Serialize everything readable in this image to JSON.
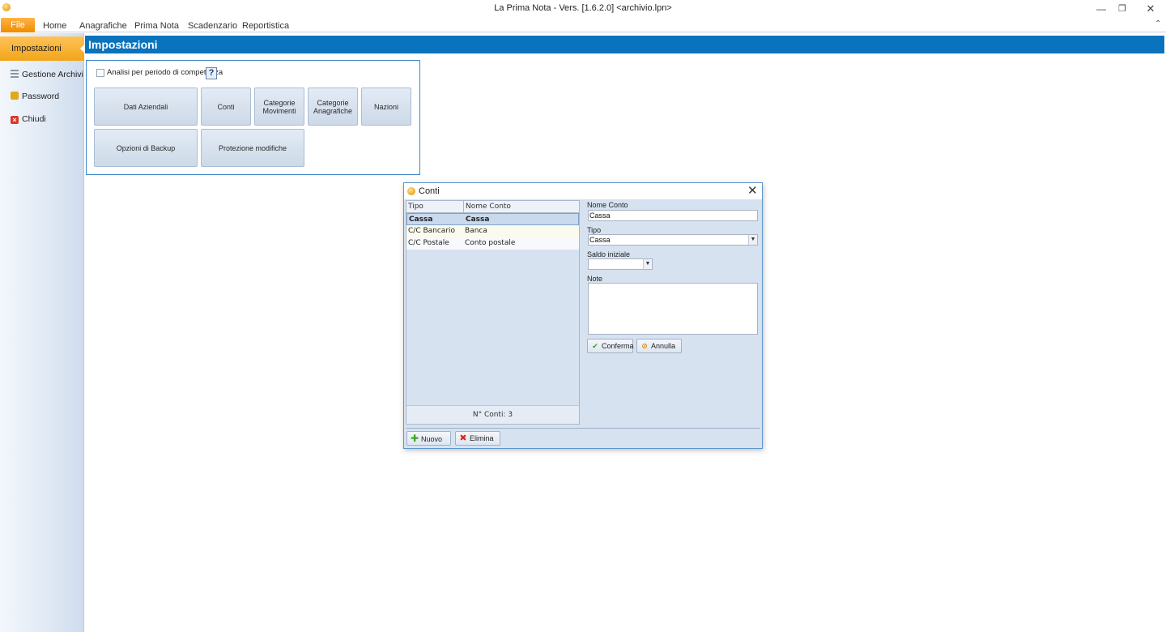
{
  "window": {
    "title": "La Prima Nota - Vers. [1.6.2.0] <archivio.lpn>",
    "controls": {
      "minimize": "—",
      "maximize": "❐",
      "close": "✕"
    }
  },
  "ribbon": {
    "tabs": [
      "File",
      "Home",
      "Anagrafiche",
      "Prima Nota",
      "Scadenzario",
      "Reportistica"
    ],
    "collapse_glyph": "⌃"
  },
  "sidebar": {
    "active": "Impostazioni",
    "items": [
      {
        "label": "Gestione Archivi",
        "icon": "list-icon"
      },
      {
        "label": "Password",
        "icon": "lock-icon"
      },
      {
        "label": "Chiudi",
        "icon": "close-icon"
      }
    ]
  },
  "header": {
    "title": "Impostazioni"
  },
  "settings": {
    "checkbox_label": "Analisi per periodo di competenza",
    "checkbox_checked": false,
    "help_label": "?",
    "buttons": {
      "dati_aziendali": "Dati Aziendali",
      "conti": "Conti",
      "categorie_movimenti_1": "Categorie",
      "categorie_movimenti_2": "Movimenti",
      "categorie_anagrafiche_1": "Categorie",
      "categorie_anagrafiche_2": "Anagrafiche",
      "nazioni": "Nazioni",
      "opzioni_backup": "Opzioni di Backup",
      "protezione_modifiche": "Protezione modifiche"
    }
  },
  "dialog": {
    "title": "Conti",
    "close": "✕",
    "grid": {
      "columns": [
        "Tipo",
        "Nome Conto"
      ],
      "rows": [
        [
          "Cassa",
          "Cassa"
        ],
        [
          "C/C Bancario",
          "Banca"
        ],
        [
          "C/C Postale",
          "Conto postale"
        ]
      ],
      "selected_row": 0,
      "footer": "N° Conti: 3"
    },
    "form": {
      "nome_conto_label": "Nome Conto",
      "nome_conto_value": "Cassa",
      "tipo_label": "Tipo",
      "tipo_value": "Cassa",
      "saldo_label": "Saldo iniziale",
      "saldo_value": "",
      "note_label": "Note",
      "note_value": ""
    },
    "buttons": {
      "conferma": "Conferma",
      "annulla": "Annulla",
      "nuovo": "Nuovo",
      "elimina": "Elimina"
    }
  }
}
